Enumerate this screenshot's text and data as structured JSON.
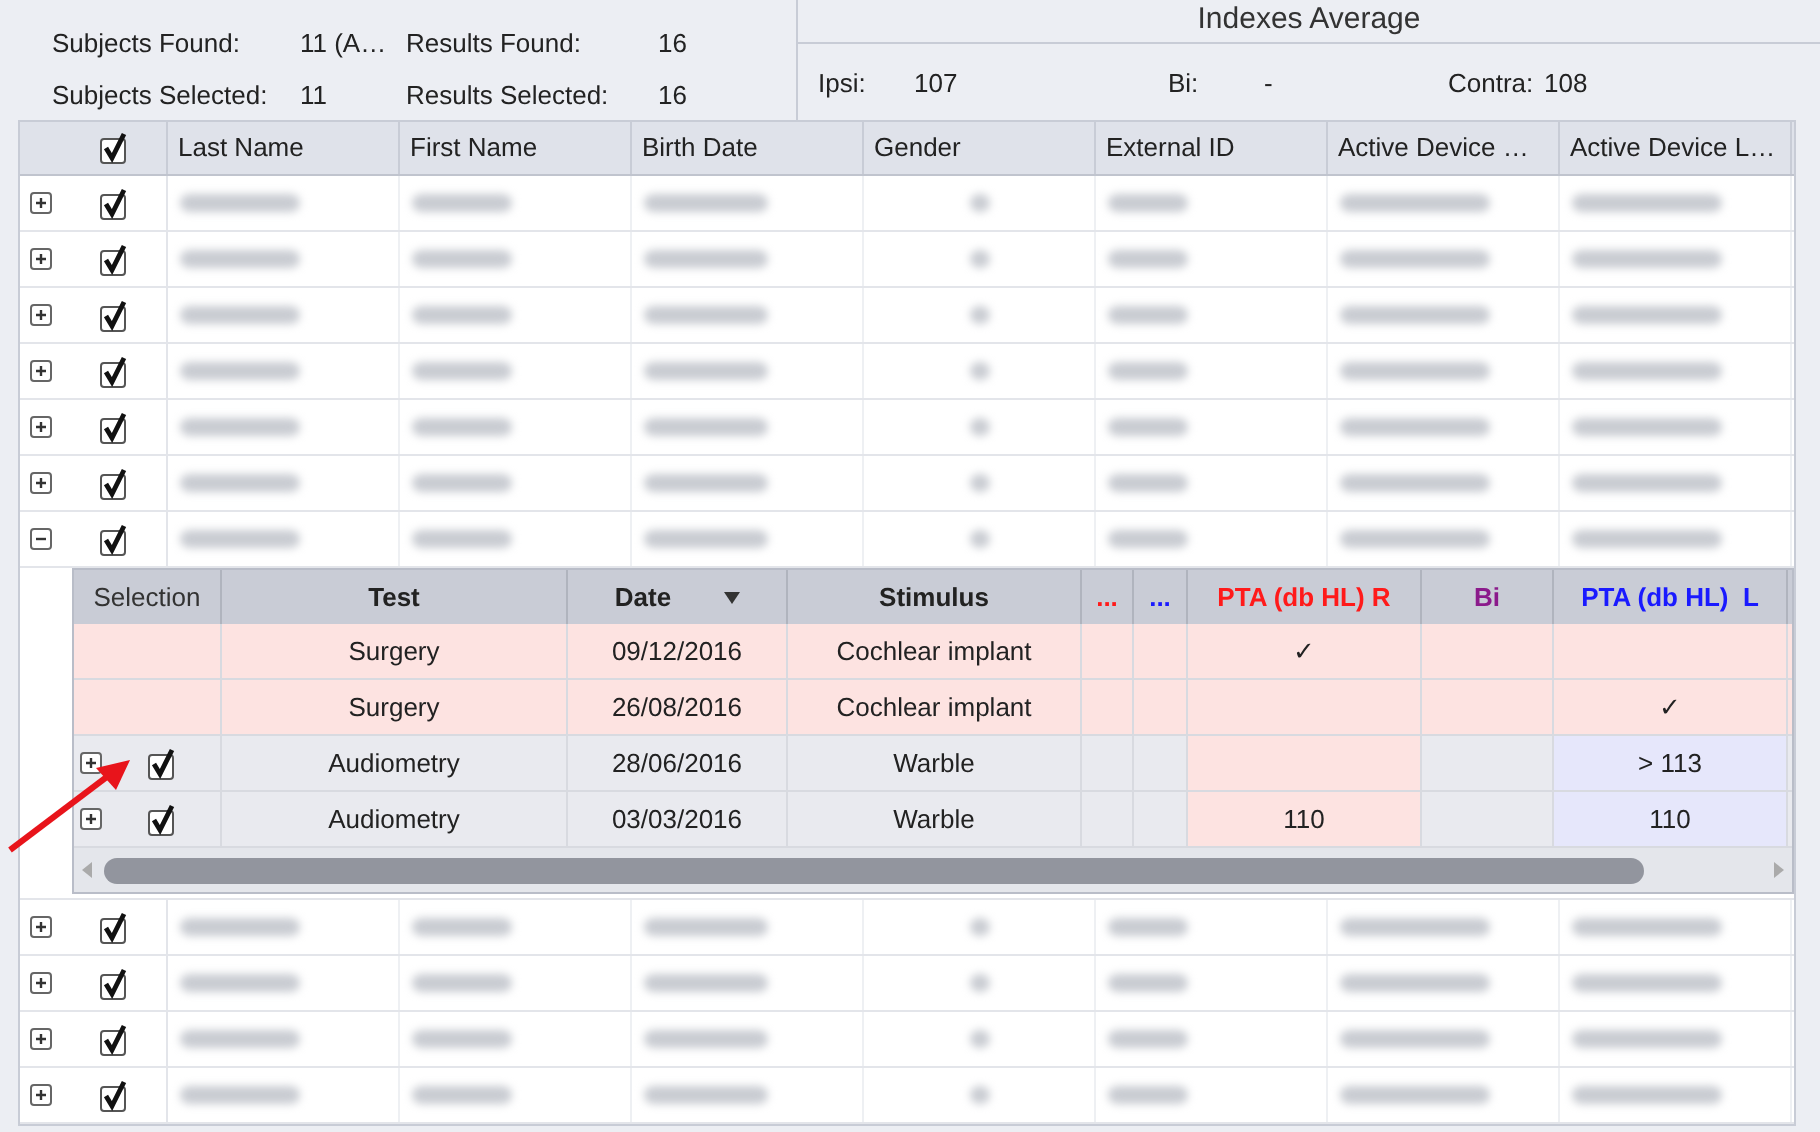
{
  "summary": {
    "left": [
      {
        "label": "Subjects Found:",
        "value": "11 (A…"
      },
      {
        "label": "Results Found:",
        "value": "16"
      },
      {
        "label": "Subjects Selected:",
        "value": "11"
      },
      {
        "label": "Results Selected:",
        "value": "16"
      }
    ],
    "indexes": {
      "title": "Indexes Average",
      "items": [
        {
          "label": "Ipsi:",
          "value": "107"
        },
        {
          "label": "Bi:",
          "value": "-"
        },
        {
          "label": "Contra:",
          "value": "108"
        }
      ]
    }
  },
  "grid": {
    "header_checked": true,
    "columns": [
      "Last Name",
      "First Name",
      "Birth Date",
      "Gender",
      "External ID",
      "Active Device …",
      "Active Device L…"
    ],
    "rows_before": [
      {
        "expanded": false,
        "checked": true
      },
      {
        "expanded": false,
        "checked": true
      },
      {
        "expanded": false,
        "checked": true
      },
      {
        "expanded": false,
        "checked": true
      },
      {
        "expanded": false,
        "checked": true
      },
      {
        "expanded": false,
        "checked": true
      },
      {
        "expanded": true,
        "checked": true
      }
    ],
    "detail": {
      "columns": [
        {
          "label": "Selection",
          "kind": "plain"
        },
        {
          "label": "Test",
          "kind": "bold"
        },
        {
          "label": "Date",
          "kind": "sorted"
        },
        {
          "label": "Stimulus",
          "kind": "bold"
        },
        {
          "label": "...",
          "kind": "right"
        },
        {
          "label": "...",
          "kind": "left"
        },
        {
          "label": "PTA (db HL) R",
          "kind": "right"
        },
        {
          "label": "Bi",
          "kind": "bi"
        },
        {
          "label": "PTA (db HL)  L",
          "kind": "left"
        }
      ],
      "rows": [
        {
          "kind": "surgery",
          "test": "Surgery",
          "date": "09/12/2016",
          "stimulus": "Cochlear implant",
          "pta_r": "✓",
          "pta_l": ""
        },
        {
          "kind": "surgery",
          "test": "Surgery",
          "date": "26/08/2016",
          "stimulus": "Cochlear implant",
          "pta_r": "",
          "pta_l": "✓"
        },
        {
          "kind": "audiometry",
          "checked": true,
          "test": "Audiometry",
          "date": "28/06/2016",
          "stimulus": "Warble",
          "pta_r": "",
          "pta_l": "> 113"
        },
        {
          "kind": "audiometry",
          "checked": true,
          "test": "Audiometry",
          "date": "03/03/2016",
          "stimulus": "Warble",
          "pta_r": "110",
          "pta_l": "110"
        }
      ]
    },
    "rows_after": [
      {
        "expanded": false,
        "checked": true
      },
      {
        "expanded": false,
        "checked": true
      },
      {
        "expanded": false,
        "checked": true
      },
      {
        "expanded": false,
        "checked": true
      }
    ]
  }
}
